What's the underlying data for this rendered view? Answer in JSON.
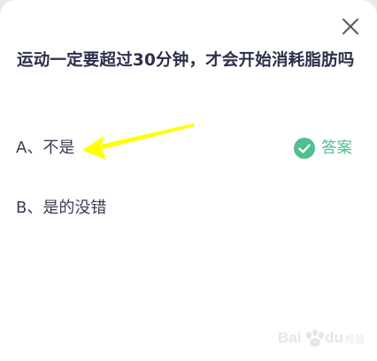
{
  "question": {
    "text": "运动一定要超过30分钟，才会开始消耗脂肪吗"
  },
  "options": [
    {
      "label": "A、不是",
      "answer_badge": "答案"
    },
    {
      "label": "B、是的没错"
    }
  ],
  "colors": {
    "accent_green": "#4fc08d",
    "arrow_yellow": "#ffff00",
    "question_text": "#2c2f4a",
    "option_text": "#3a3d52"
  },
  "icons": {
    "close": "close-icon",
    "answer": "check-circle-icon",
    "annotation": "arrow-annotation",
    "watermark": "baidu-logo-watermark"
  },
  "watermark": {
    "text": "Baidu经验"
  }
}
